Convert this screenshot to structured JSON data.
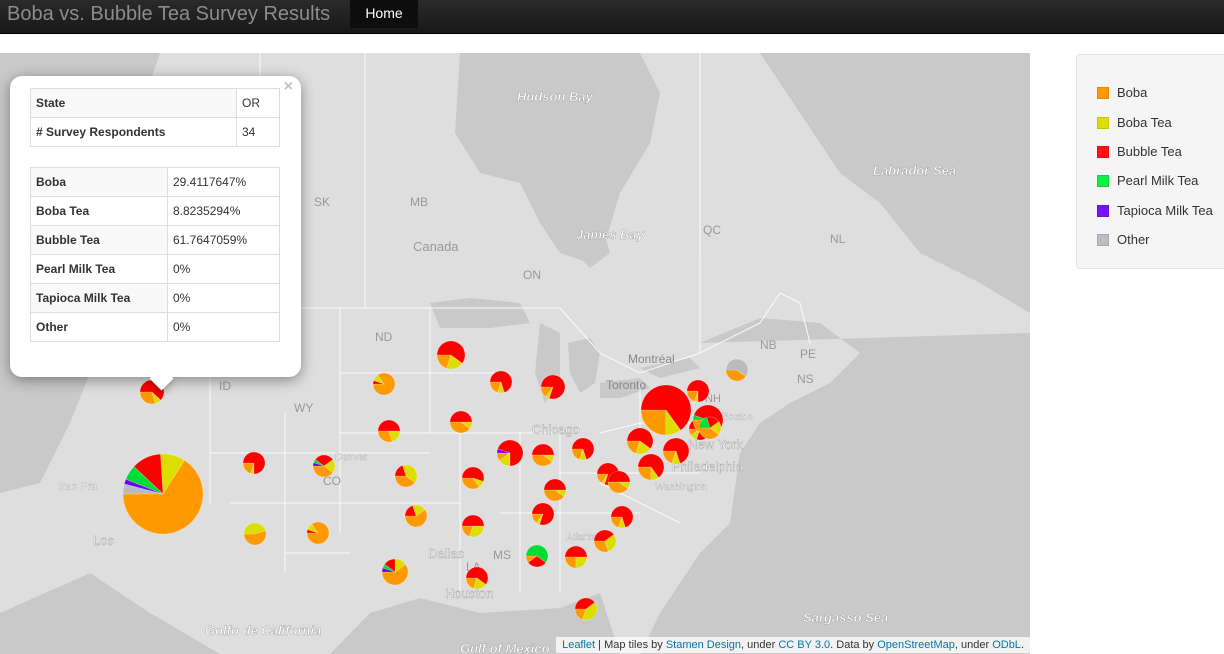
{
  "header": {
    "title": "Boba vs. Bubble Tea Survey Results",
    "nav_home": "Home"
  },
  "colors": {
    "boba": "#ff9900",
    "boba_tea": "#dddd00",
    "bubble_tea": "#ff0000",
    "pearl_milk_tea": "#00dd33",
    "tapioca_milk_tea": "#6600ff",
    "other": "#bbbbbb"
  },
  "legend": [
    {
      "label": "Boba",
      "color": "#ff9900"
    },
    {
      "label": "Boba Tea",
      "color": "#dddd00"
    },
    {
      "label": "Bubble Tea",
      "color": "#ff1111"
    },
    {
      "label": "Pearl Milk Tea",
      "color": "#11ee44"
    },
    {
      "label": "Tapioca Milk Tea",
      "color": "#7711ff"
    },
    {
      "label": "Other",
      "color": "#bbbbc4"
    }
  ],
  "popup": {
    "close": "×",
    "state_label": "State",
    "state_value": "OR",
    "respondents_label": "# Survey Respondents",
    "respondents_value": "34",
    "rows": [
      {
        "label": "Boba",
        "value": "29.4117647%"
      },
      {
        "label": "Boba Tea",
        "value": "8.8235294%"
      },
      {
        "label": "Bubble Tea",
        "value": "61.7647059%"
      },
      {
        "label": "Pearl Milk Tea",
        "value": "0%"
      },
      {
        "label": "Tapioca Milk Tea",
        "value": "0%"
      },
      {
        "label": "Other",
        "value": "0%"
      }
    ]
  },
  "map_labels": [
    "Hudson Bay",
    "Labrador Sea",
    "James Bay",
    "Canada",
    "SK",
    "MB",
    "QC",
    "NL",
    "ON",
    "ND",
    "WY",
    "CO",
    "ID",
    "NB",
    "PE",
    "NS",
    "Montréal",
    "Toronto",
    "Chicago",
    "New York",
    "Philadelphia",
    "Washington",
    "Dallas",
    "Houston",
    "MS",
    "LA",
    "Atlanta",
    "Denver",
    "San Fra",
    "Los",
    "Boston",
    "NH",
    "Sargasso Sea",
    "Golfo de California",
    "Gulf of Mexico"
  ],
  "attribution": {
    "leaflet": "Leaflet",
    "t1": " | Map tiles by ",
    "stamen": "Stamen Design",
    "t2": ", under ",
    "ccby": "CC BY 3.0",
    "t3": ". Data by ",
    "osm": "OpenStreetMap",
    "t4": ", under ",
    "odbl": "ODbL",
    "t5": "."
  }
}
